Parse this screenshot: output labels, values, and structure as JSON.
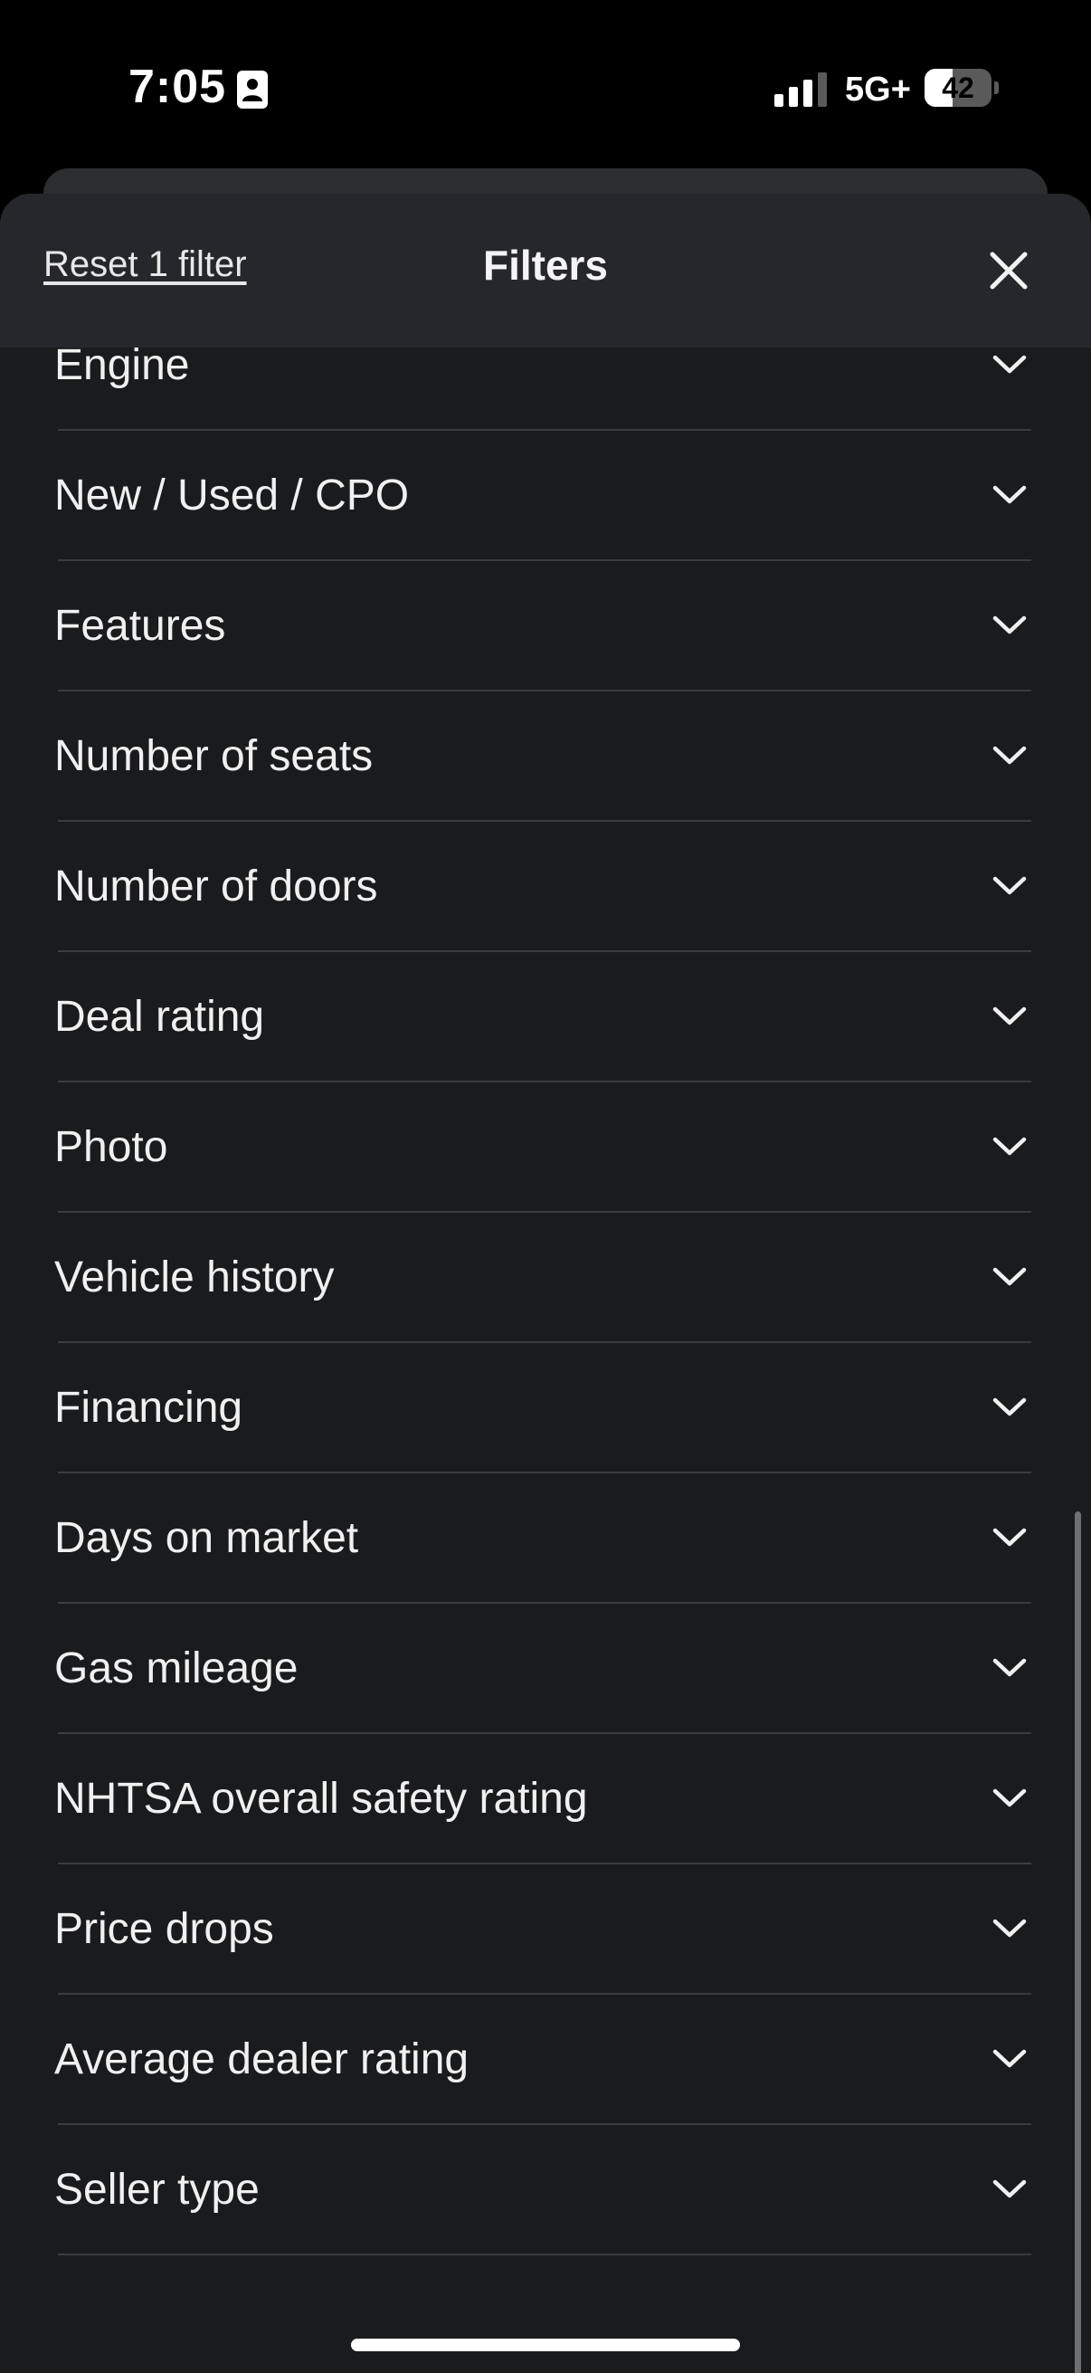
{
  "status_bar": {
    "time": "7:05",
    "network": "5G+",
    "battery_level": "42",
    "battery_fraction": 0.42
  },
  "header": {
    "reset_label": "Reset 1 filter",
    "title": "Filters",
    "close_icon": "close-icon"
  },
  "filters": [
    {
      "label": "Engine"
    },
    {
      "label": "New / Used / CPO"
    },
    {
      "label": "Features"
    },
    {
      "label": "Number of seats"
    },
    {
      "label": "Number of doors"
    },
    {
      "label": "Deal rating"
    },
    {
      "label": "Photo"
    },
    {
      "label": "Vehicle history"
    },
    {
      "label": "Financing"
    },
    {
      "label": "Days on market"
    },
    {
      "label": "Gas mileage"
    },
    {
      "label": "NHTSA overall safety rating"
    },
    {
      "label": "Price drops"
    },
    {
      "label": "Average dealer rating"
    },
    {
      "label": "Seller type"
    }
  ],
  "icons": {
    "row_expand": "chevron-down-icon"
  },
  "colors": {
    "sheet_background": "#1a1b1d",
    "header_background": "#25272a",
    "divider": "#3a3c3f",
    "text": "#f0f0f0"
  }
}
